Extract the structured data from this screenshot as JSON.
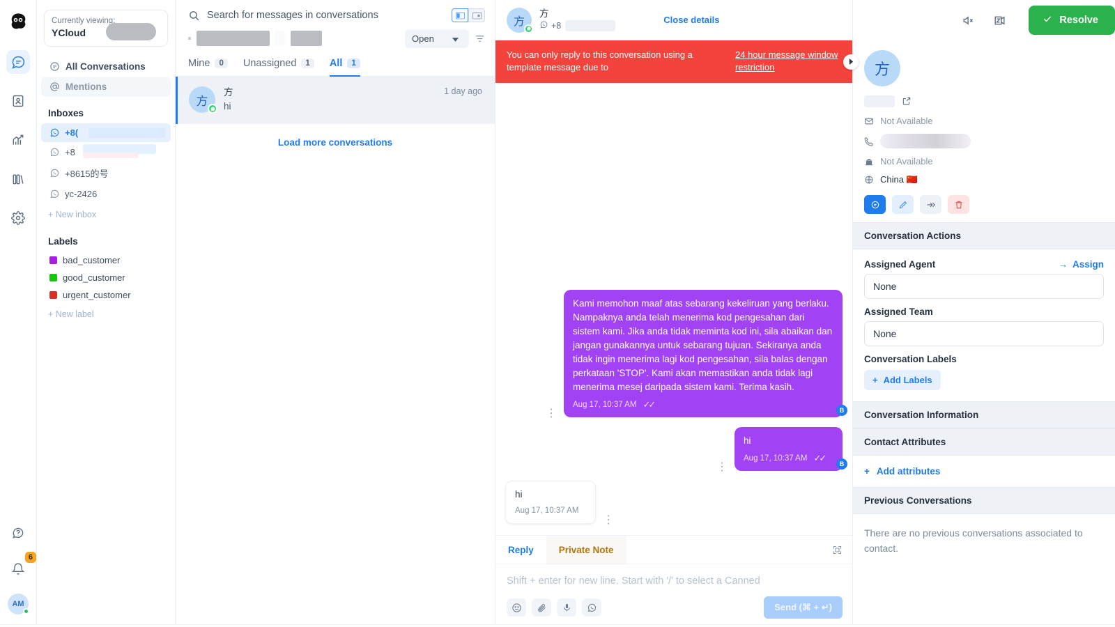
{
  "rail": {
    "logo": "owl-logo",
    "icons": [
      {
        "name": "conversations-icon",
        "active": true
      },
      {
        "name": "contacts-icon",
        "active": false
      },
      {
        "name": "reports-icon",
        "active": false
      },
      {
        "name": "campaigns-icon",
        "active": false
      },
      {
        "name": "settings-icon",
        "active": false
      }
    ],
    "help_icon": "help-icon",
    "notifications_icon": "bell-icon",
    "notifications_count": "6",
    "avatar_initials": "AM"
  },
  "sidebar": {
    "viewing_label": "Currently viewing:",
    "viewing_account": "YCloud",
    "nav": [
      {
        "label": "All Conversations",
        "icon": "chat-icon"
      },
      {
        "label": "Mentions",
        "icon": "at-icon"
      }
    ],
    "inboxes_title": "Inboxes",
    "inboxes": [
      {
        "label": "+8(",
        "icon": "whatsapp-icon",
        "active": true
      },
      {
        "label": "+8",
        "icon": "whatsapp-icon",
        "active": false
      },
      {
        "label": "+8615的号",
        "icon": "whatsapp-icon",
        "active": false
      },
      {
        "label": "yc-2426",
        "icon": "whatsapp-icon",
        "active": false
      }
    ],
    "new_inbox": "+ New inbox",
    "labels_title": "Labels",
    "labels": [
      {
        "label": "bad_customer",
        "color": "#a41fe0"
      },
      {
        "label": "good_customer",
        "color": "#16c60c"
      },
      {
        "label": "urgent_customer",
        "color": "#d93025"
      }
    ],
    "new_label": "+ New label"
  },
  "conversation_list": {
    "search_placeholder": "Search for messages in conversations",
    "search_value": "",
    "status_filter": "Open",
    "tabs": [
      {
        "label": "Mine",
        "count": "0",
        "active": false
      },
      {
        "label": "Unassigned",
        "count": "1",
        "active": false
      },
      {
        "label": "All",
        "count": "1",
        "active": true
      }
    ],
    "items": [
      {
        "avatar": "方",
        "name": "方",
        "preview": "hi",
        "time": "1 day ago",
        "channel": "whatsapp-icon"
      }
    ],
    "load_more": "Load more conversations"
  },
  "conversation": {
    "header": {
      "avatar": "方",
      "name": "方",
      "phone_prefix": "+8",
      "close_details": "Close details"
    },
    "banner": {
      "text": "You can only reply to this conversation using a template message due to",
      "link": "24 hour message window restriction"
    },
    "messages": [
      {
        "direction": "outgoing",
        "text": "Kami memohon maaf atas sebarang kekeliruan yang berlaku. Nampaknya anda telah menerima kod pengesahan dari sistem kami. Jika anda tidak meminta kod ini, sila abaikan dan jangan gunakannya untuk sebarang tujuan. Sekiranya anda tidak ingin menerima lagi kod pengesahan, sila balas dengan perkataan 'STOP'. Kami akan memastikan anda tidak lagi menerima mesej daripada sistem kami. Terima kasih.",
        "time": "Aug 17, 10:37 AM",
        "status": "delivered",
        "sender_initial": "B"
      },
      {
        "direction": "outgoing",
        "text": "hi",
        "time": "Aug 17, 10:37 AM",
        "status": "delivered",
        "sender_initial": "B"
      },
      {
        "direction": "incoming",
        "text": "hi",
        "time": "Aug 17, 10:37 AM",
        "status": "",
        "sender_initial": ""
      }
    ],
    "reply": {
      "tabs": [
        {
          "label": "Reply",
          "active": true
        },
        {
          "label": "Private Note",
          "active": false
        }
      ],
      "placeholder": "Shift + enter for new line. Start with '/' to select a Canned",
      "actions": [
        "emoji-icon",
        "attachment-icon",
        "microphone-icon",
        "whatsapp-template-icon"
      ],
      "send_label": "Send (⌘ + ↵)",
      "expand_icon": "expand-icon"
    }
  },
  "topbar": {
    "mute_icon": "speaker-mute-icon",
    "snooze_icon": "snooze-icon",
    "resolve_label": "Resolve"
  },
  "contact_panel": {
    "avatar": "方",
    "external_link_icon": "external-link-icon",
    "email": "Not Available",
    "company": "Not Available",
    "country": "China 🇨🇳",
    "actions": [
      {
        "name": "message-icon",
        "style": "primary"
      },
      {
        "name": "edit-icon",
        "style": "light"
      },
      {
        "name": "merge-icon",
        "style": "grey"
      },
      {
        "name": "delete-icon",
        "style": "danger"
      }
    ],
    "sections": {
      "conversation_actions": "Conversation Actions",
      "conversation_information": "Conversation Information",
      "contact_attributes": "Contact Attributes",
      "previous_conversations": "Previous Conversations"
    },
    "assigned_agent_label": "Assigned Agent",
    "assign_link": "Assign",
    "assigned_agent_value": "None",
    "assigned_team_label": "Assigned Team",
    "assigned_team_value": "None",
    "conversation_labels_label": "Conversation Labels",
    "add_labels": "Add Labels",
    "add_attributes": "Add attributes",
    "previous_empty": "There are no previous conversations associated to contact."
  },
  "colors": {
    "accent": "#1f7ced",
    "bubble_out": "#a142f5",
    "banner": "#f4423c",
    "resolve": "#2bb24c",
    "whatsapp": "#25d366"
  }
}
